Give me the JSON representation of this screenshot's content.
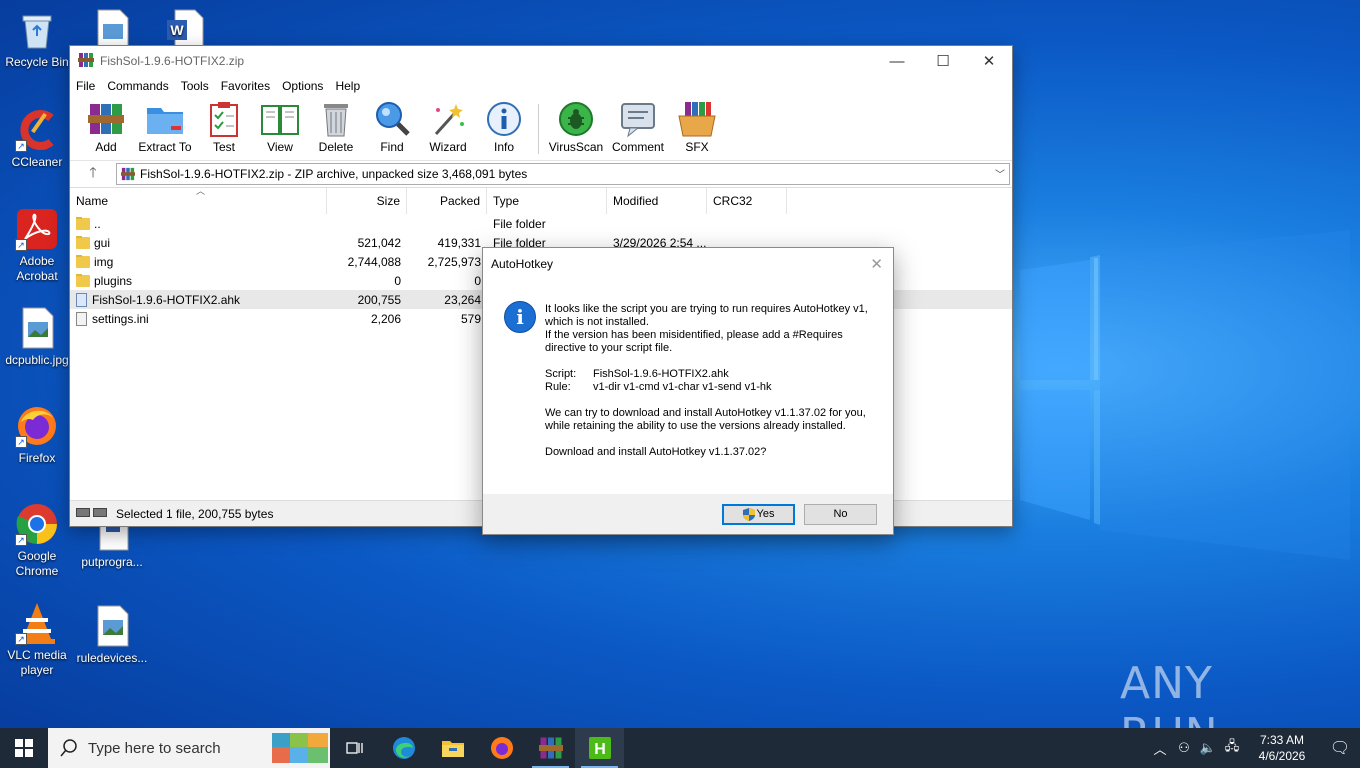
{
  "desktop": {
    "icons": [
      {
        "label": "Recycle Bin",
        "icon": "recycle-bin-icon"
      },
      {
        "label": "CCleaner",
        "icon": "ccleaner-icon"
      },
      {
        "label": "Adobe Acrobat",
        "icon": "acrobat-icon"
      },
      {
        "label": "dcpublic.jpg",
        "icon": "image-file-icon"
      },
      {
        "label": "Firefox",
        "icon": "firefox-icon"
      },
      {
        "label": "Google Chrome",
        "icon": "chrome-icon"
      },
      {
        "label": "VLC media player",
        "icon": "vlc-icon"
      },
      {
        "label": "putprogra...",
        "icon": "word-doc-icon"
      },
      {
        "label": "ruledevices...",
        "icon": "image-file-icon"
      }
    ],
    "watermark": "ANY RUN"
  },
  "winrar": {
    "title": "FishSol-1.9.6-HOTFIX2.zip",
    "menu": [
      "File",
      "Commands",
      "Tools",
      "Favorites",
      "Options",
      "Help"
    ],
    "toolbar": [
      "Add",
      "Extract To",
      "Test",
      "View",
      "Delete",
      "Find",
      "Wizard",
      "Info",
      "VirusScan",
      "Comment",
      "SFX"
    ],
    "address": "FishSol-1.9.6-HOTFIX2.zip - ZIP archive, unpacked size 3,468,091 bytes",
    "columns": {
      "name": "Name",
      "size": "Size",
      "packed": "Packed",
      "type": "Type",
      "modified": "Modified",
      "crc": "CRC32"
    },
    "rows": [
      {
        "name": "..",
        "size": "",
        "packed": "",
        "type": "File folder",
        "modified": "",
        "kind": "folder"
      },
      {
        "name": "gui",
        "size": "521,042",
        "packed": "419,331",
        "type": "File folder",
        "modified": "3/29/2026 2:54 ...",
        "kind": "folder"
      },
      {
        "name": "img",
        "size": "2,744,088",
        "packed": "2,725,973",
        "type": "",
        "modified": "",
        "kind": "folder"
      },
      {
        "name": "plugins",
        "size": "0",
        "packed": "0",
        "type": "",
        "modified": "",
        "kind": "folder"
      },
      {
        "name": "FishSol-1.9.6-HOTFIX2.ahk",
        "size": "200,755",
        "packed": "23,264",
        "type": "",
        "modified": "",
        "kind": "ahk"
      },
      {
        "name": "settings.ini",
        "size": "2,206",
        "packed": "579",
        "type": "",
        "modified": "",
        "kind": "ini"
      }
    ],
    "status": "Selected 1 file, 200,755 bytes"
  },
  "dialog": {
    "title": "AutoHotkey",
    "para1": "It looks like the script you are trying to run requires AutoHotkey v1, which is not installed.",
    "para1b": "If the version has been misidentified, please add a #Requires directive to your script file.",
    "script_label": "Script:",
    "script_value": "FishSol-1.9.6-HOTFIX2.ahk",
    "rule_label": "Rule:",
    "rule_value": "v1-dir v1-cmd v1-char v1-send v1-hk",
    "para3": "We can try to download and install AutoHotkey v1.1.37.02 for you, while retaining the ability to use the versions already installed.",
    "para4": "Download and install AutoHotkey v1.1.37.02?",
    "yes": "Yes",
    "no": "No"
  },
  "taskbar": {
    "search_placeholder": "Type here to search",
    "time": "7:33 AM",
    "date": "4/6/2026"
  }
}
